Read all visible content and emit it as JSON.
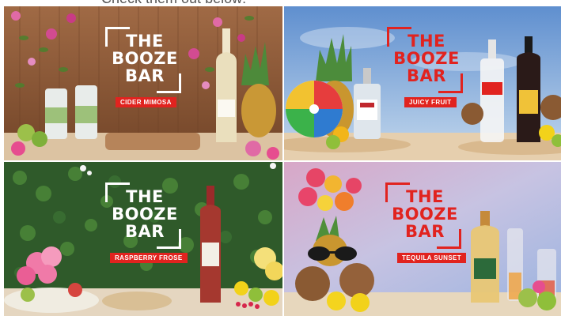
{
  "caption": "Check them out below:",
  "tiles": [
    {
      "logo_lines": [
        "THE",
        "BOOZE",
        "BAR"
      ],
      "badge": "CIDER MIMOSA",
      "logo_color": "#ffffff"
    },
    {
      "logo_lines": [
        "THE",
        "BOOZE",
        "BAR"
      ],
      "badge": "JUICY FRUIT",
      "logo_color": "#e1231f"
    },
    {
      "logo_lines": [
        "THE",
        "BOOZE",
        "BAR"
      ],
      "badge": "RASPBERRY FROSE",
      "logo_color": "#ffffff"
    },
    {
      "logo_lines": [
        "THE",
        "BOOZE",
        "BAR"
      ],
      "badge": "TEQUILA SUNSET",
      "logo_color": "#e1231f"
    }
  ],
  "brand": "#e1231f",
  "icons": [
    "bottle-icon",
    "can-icon",
    "pineapple-icon",
    "beach-ball-icon",
    "coconut-icon",
    "sunglasses-icon",
    "flower-icon"
  ]
}
